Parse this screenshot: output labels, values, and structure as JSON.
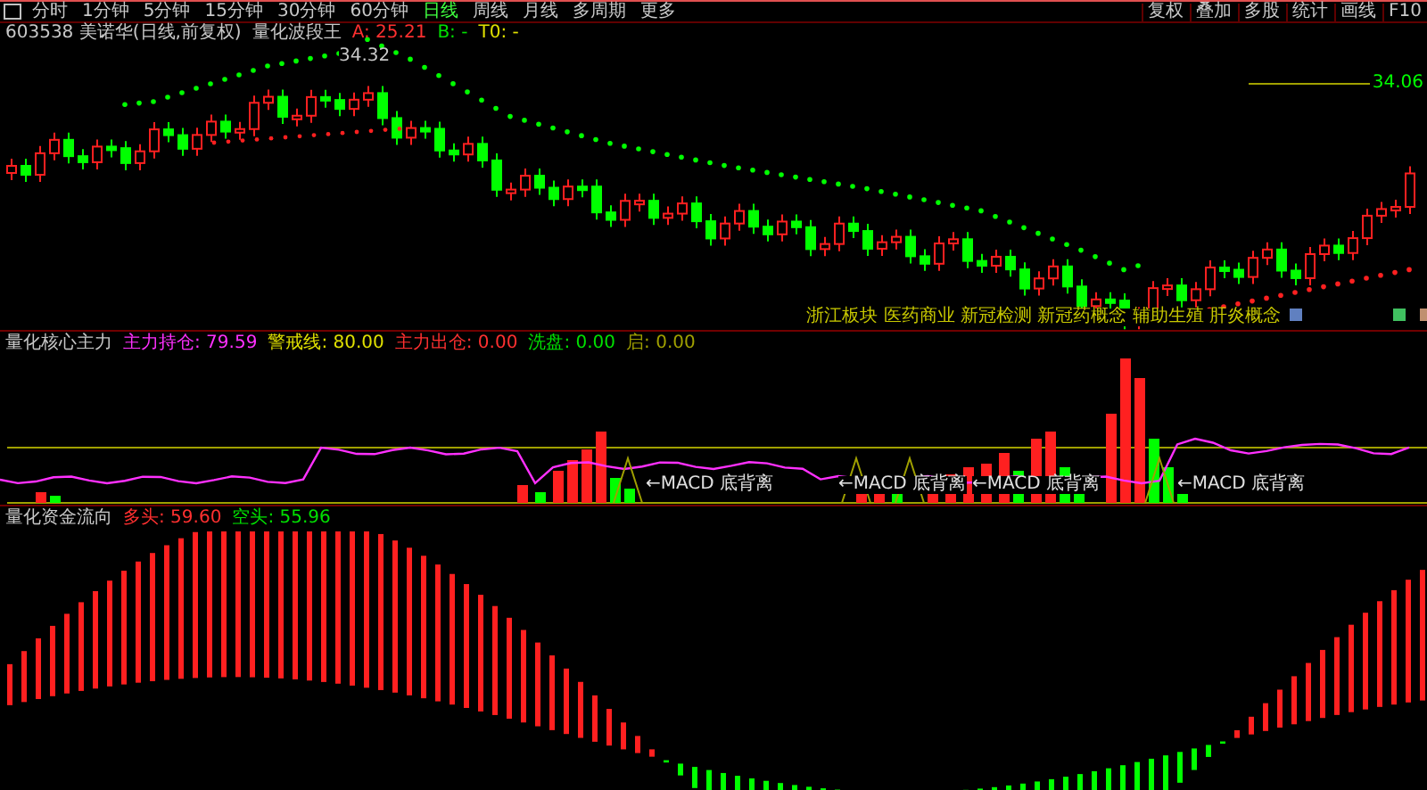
{
  "period_tabs": [
    {
      "label": "分时",
      "selected": false
    },
    {
      "label": "1分钟",
      "selected": false
    },
    {
      "label": "5分钟",
      "selected": false
    },
    {
      "label": "15分钟",
      "selected": false
    },
    {
      "label": "30分钟",
      "selected": false
    },
    {
      "label": "60分钟",
      "selected": false
    },
    {
      "label": "日线",
      "selected": true
    },
    {
      "label": "周线",
      "selected": false
    },
    {
      "label": "月线",
      "selected": false
    },
    {
      "label": "多周期",
      "selected": false
    },
    {
      "label": "更多",
      "selected": false
    }
  ],
  "toolbar_buttons": [
    "复权",
    "叠加",
    "多股",
    "统计",
    "画线",
    "F10"
  ],
  "main_pane": {
    "stock": "603538 美诺华(日线,前复权)",
    "indicator": "量化波段王",
    "values": [
      {
        "text": "A: 25.21",
        "color": "#ff3030"
      },
      {
        "text": "B: -",
        "color": "#00e000"
      },
      {
        "text": "T0: -",
        "color": "#e0e000"
      }
    ],
    "high_label": "34.32",
    "right_label": "34.06",
    "concepts": "浙江板块 医药商业 新冠检测 新冠药概念 辅助生殖 肝炎概念"
  },
  "pane_2": {
    "indicator": "量化核心主力",
    "values": [
      {
        "text": "主力持仓: 79.59",
        "color": "#ff30ff"
      },
      {
        "text": "警戒线: 80.00",
        "color": "#e0e000"
      },
      {
        "text": "主力出仓: 0.00",
        "color": "#ff3030"
      },
      {
        "text": "洗盘: 0.00",
        "color": "#00e000"
      },
      {
        "text": "启: 0.00",
        "color": "#a0a000"
      }
    ],
    "signals": [
      "←MACD 底背离",
      "←MACD 底背离",
      "←MACD 底背离",
      "←MACD 底背离"
    ]
  },
  "pane_3": {
    "indicator": "量化资金流向",
    "values": [
      {
        "text": "多头: 59.60",
        "color": "#ff3030"
      },
      {
        "text": "空头: 55.96",
        "color": "#00e000"
      }
    ]
  }
}
